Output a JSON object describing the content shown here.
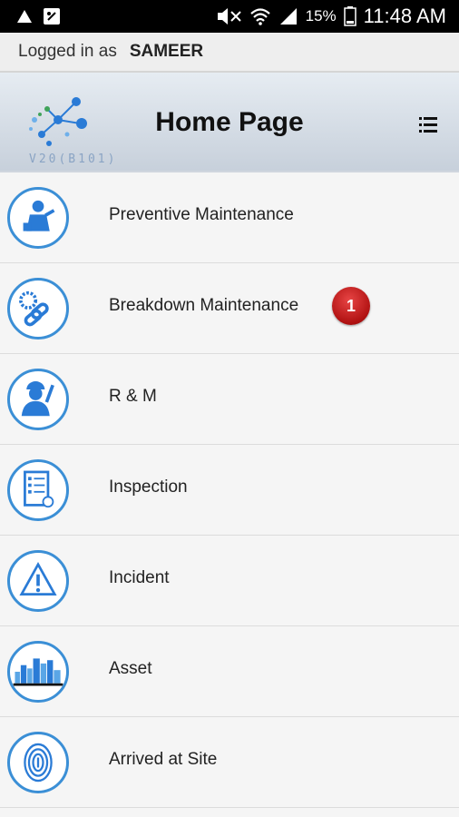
{
  "status_bar": {
    "battery": "15%",
    "time": "11:48 AM",
    "icons": [
      "signal-icon",
      "sim-alert-icon",
      "mute-icon",
      "wifi-icon",
      "cell-signal-icon",
      "battery-icon"
    ]
  },
  "session": {
    "label": "Logged in as",
    "user": "SAMEER"
  },
  "header": {
    "title": "Home Page",
    "version": "V20(B101)"
  },
  "menu": {
    "items": [
      {
        "label": "Preventive Maintenance",
        "icon": "maintenance-worker-icon"
      },
      {
        "label": "Breakdown Maintenance",
        "icon": "broken-chain-icon",
        "badge": "1"
      },
      {
        "label": "R & M",
        "icon": "technician-icon"
      },
      {
        "label": "Inspection",
        "icon": "checklist-icon"
      },
      {
        "label": "Incident",
        "icon": "warning-triangle-icon"
      },
      {
        "label": "Asset",
        "icon": "city-skyline-icon"
      },
      {
        "label": "Arrived at Site",
        "icon": "fingerprint-icon"
      }
    ]
  },
  "colors": {
    "accent": "#3b8fd6",
    "badge": "#c41a1a",
    "header_top": "#e6ecf2",
    "header_bottom": "#c7d0db"
  }
}
